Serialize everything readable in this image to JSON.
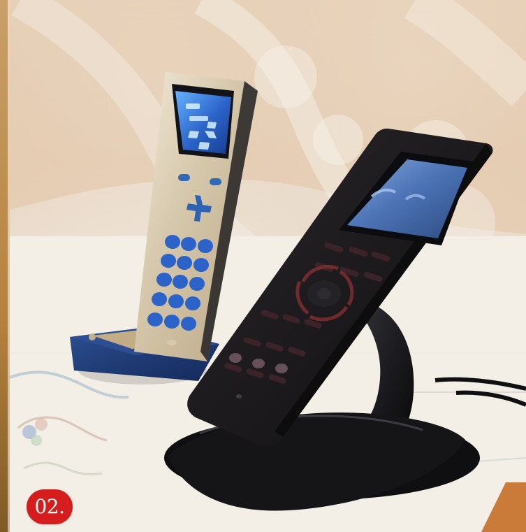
{
  "badge": {
    "label": "02."
  },
  "colors": {
    "badge_red": "#d51d1d",
    "silver_remote": "#d8cbb1",
    "black_remote": "#1d1a1d",
    "screen_blue": "#2b63c9",
    "base_blue": "#13295a"
  }
}
